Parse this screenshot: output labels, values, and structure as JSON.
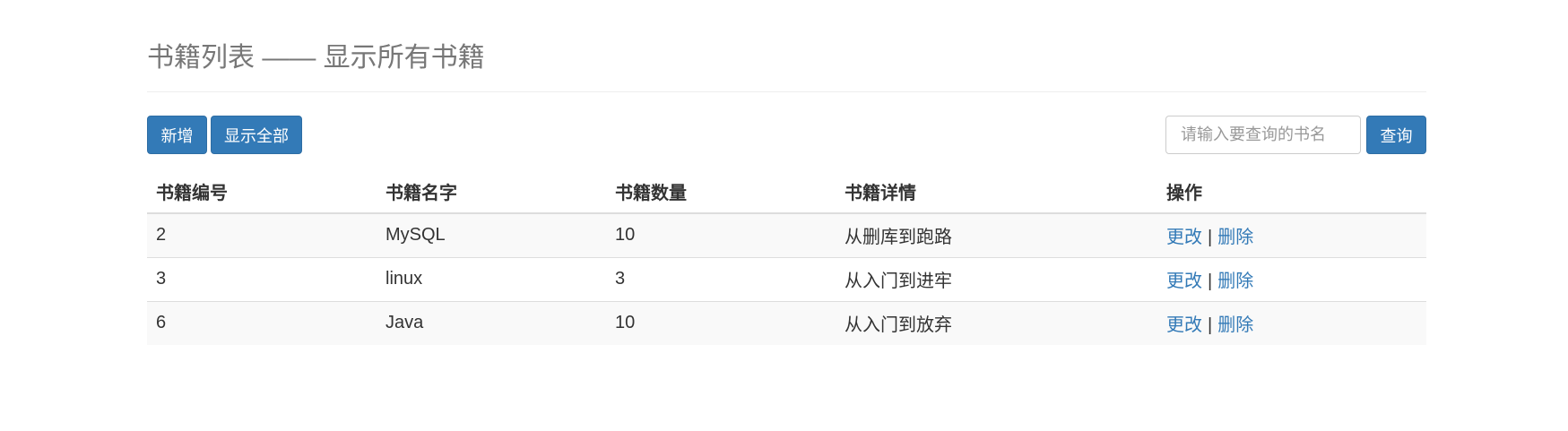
{
  "header": {
    "title": "书籍列表 —— 显示所有书籍"
  },
  "toolbar": {
    "add_label": "新增",
    "show_all_label": "显示全部",
    "search_placeholder": "请输入要查询的书名",
    "search_value": "",
    "query_label": "查询"
  },
  "table": {
    "columns": [
      "书籍编号",
      "书籍名字",
      "书籍数量",
      "书籍详情",
      "操作"
    ],
    "rows": [
      {
        "id": "2",
        "name": "MySQL",
        "count": "10",
        "detail": "从删库到跑路"
      },
      {
        "id": "3",
        "name": "linux",
        "count": "3",
        "detail": "从入门到进牢"
      },
      {
        "id": "6",
        "name": "Java",
        "count": "10",
        "detail": "从入门到放弃"
      }
    ],
    "actions": {
      "edit_label": "更改",
      "separator": "|",
      "delete_label": "删除"
    }
  },
  "colors": {
    "primary": "#337ab7",
    "title_gray": "#777777",
    "stripe": "#f9f9f9",
    "border": "#dddddd"
  }
}
